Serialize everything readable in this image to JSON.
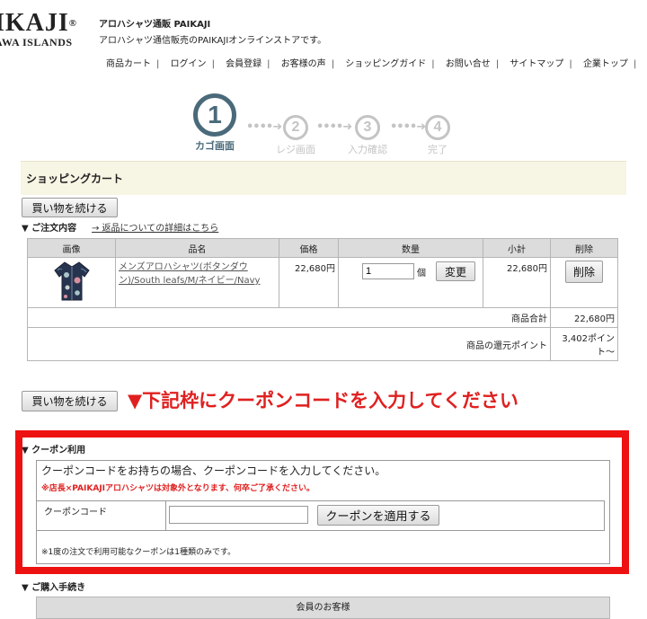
{
  "header": {
    "logo_text": "IKAJI",
    "logo_reg": "®",
    "logo_sub": "AWA ISLANDS",
    "shop_name": "アロハシャツ通販 PAIKAJI",
    "shop_desc": "アロハシャツ通信販売のPAIKAJIオンラインストアです。",
    "nav": [
      "商品カート",
      "ログイン",
      "会員登録",
      "お客様の声",
      "ショッピングガイド",
      "お問い合せ",
      "サイトマップ",
      "企業トップ"
    ]
  },
  "steps": [
    {
      "number": "1",
      "label": "カゴ画面",
      "active": true
    },
    {
      "number": "2",
      "label": "レジ画面",
      "active": false
    },
    {
      "number": "3",
      "label": "入力確認",
      "active": false
    },
    {
      "number": "4",
      "label": "完了",
      "active": false
    }
  ],
  "cart": {
    "title": "ショッピングカート",
    "continue_label": "買い物を続ける",
    "order_title": "▼ ご注文内容",
    "return_link": "→ 返品についての詳細はこちら",
    "columns": [
      "画像",
      "品名",
      "価格",
      "数量",
      "小計",
      "削除"
    ],
    "item": {
      "name": "メンズアロハシャツ(ボタンダウン)/South leafs/M/ネイビー/Navy",
      "price": "22,680円",
      "qty": "1",
      "qty_unit": "個",
      "change_label": "変更",
      "subtotal": "22,680円",
      "delete_label": "削除"
    },
    "total_label": "商品合計",
    "total_value": "22,680円",
    "points_label": "商品の還元ポイント",
    "points_value": "3,402ポイント～"
  },
  "instruction": "▼下記枠にクーポンコードを入力してください",
  "coupon": {
    "title": "▼ クーポン利用",
    "prompt": "クーポンコードをお持ちの場合、クーポンコードを入力してください。",
    "note": "※店長×PAIKAJIアロハシャツは対象外となります、何卒ご了承ください。",
    "code_label": "クーポンコード",
    "code_value": "",
    "apply_label": "クーポンを適用する",
    "footnote": "※1度の注文で利用可能なクーポンは1種類のみです。"
  },
  "purchase": {
    "title": "▼ ご購入手続き",
    "member_head": "会員のお客様"
  },
  "colors": {
    "accent_red": "#ee1111",
    "step_active": "#4a6a7a",
    "step_inactive": "#c4c4c4",
    "cart_head_bg": "#f7f5e3"
  }
}
